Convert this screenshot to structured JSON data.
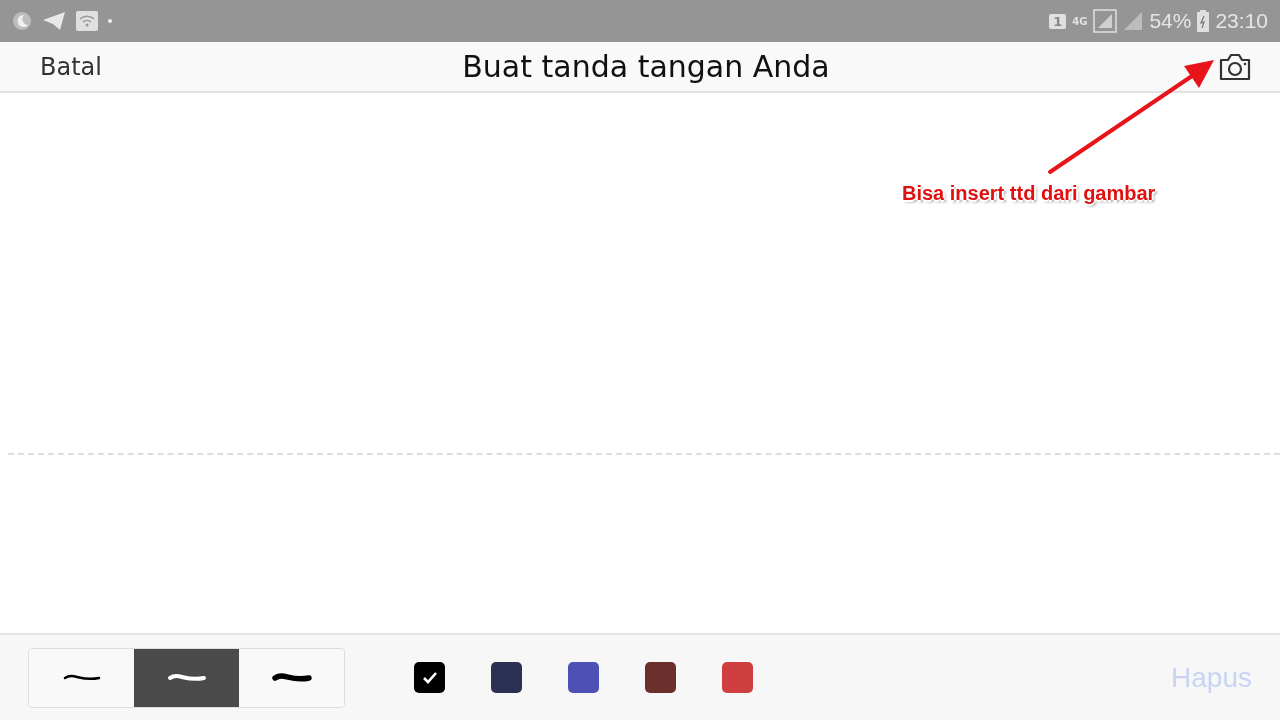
{
  "status_bar": {
    "sim_slot": "1",
    "network": "4G",
    "battery": "54%",
    "time": "23:10"
  },
  "header": {
    "cancel": "Batal",
    "title": "Buat tanda tangan Anda"
  },
  "annotation": {
    "text": "Bisa insert ttd dari gambar"
  },
  "pen_widths": [
    {
      "kind": "thin",
      "selected": false
    },
    {
      "kind": "medium",
      "selected": true
    },
    {
      "kind": "thick",
      "selected": false
    }
  ],
  "colors": [
    {
      "color": "#000000",
      "selected": true
    },
    {
      "color": "#2c3154",
      "selected": false
    },
    {
      "color": "#4d50b4",
      "selected": false
    },
    {
      "color": "#6b2f2c",
      "selected": false
    },
    {
      "color": "#cf3f3f",
      "selected": false
    }
  ],
  "clear_button": {
    "label": "Hapus",
    "disabled": true
  }
}
